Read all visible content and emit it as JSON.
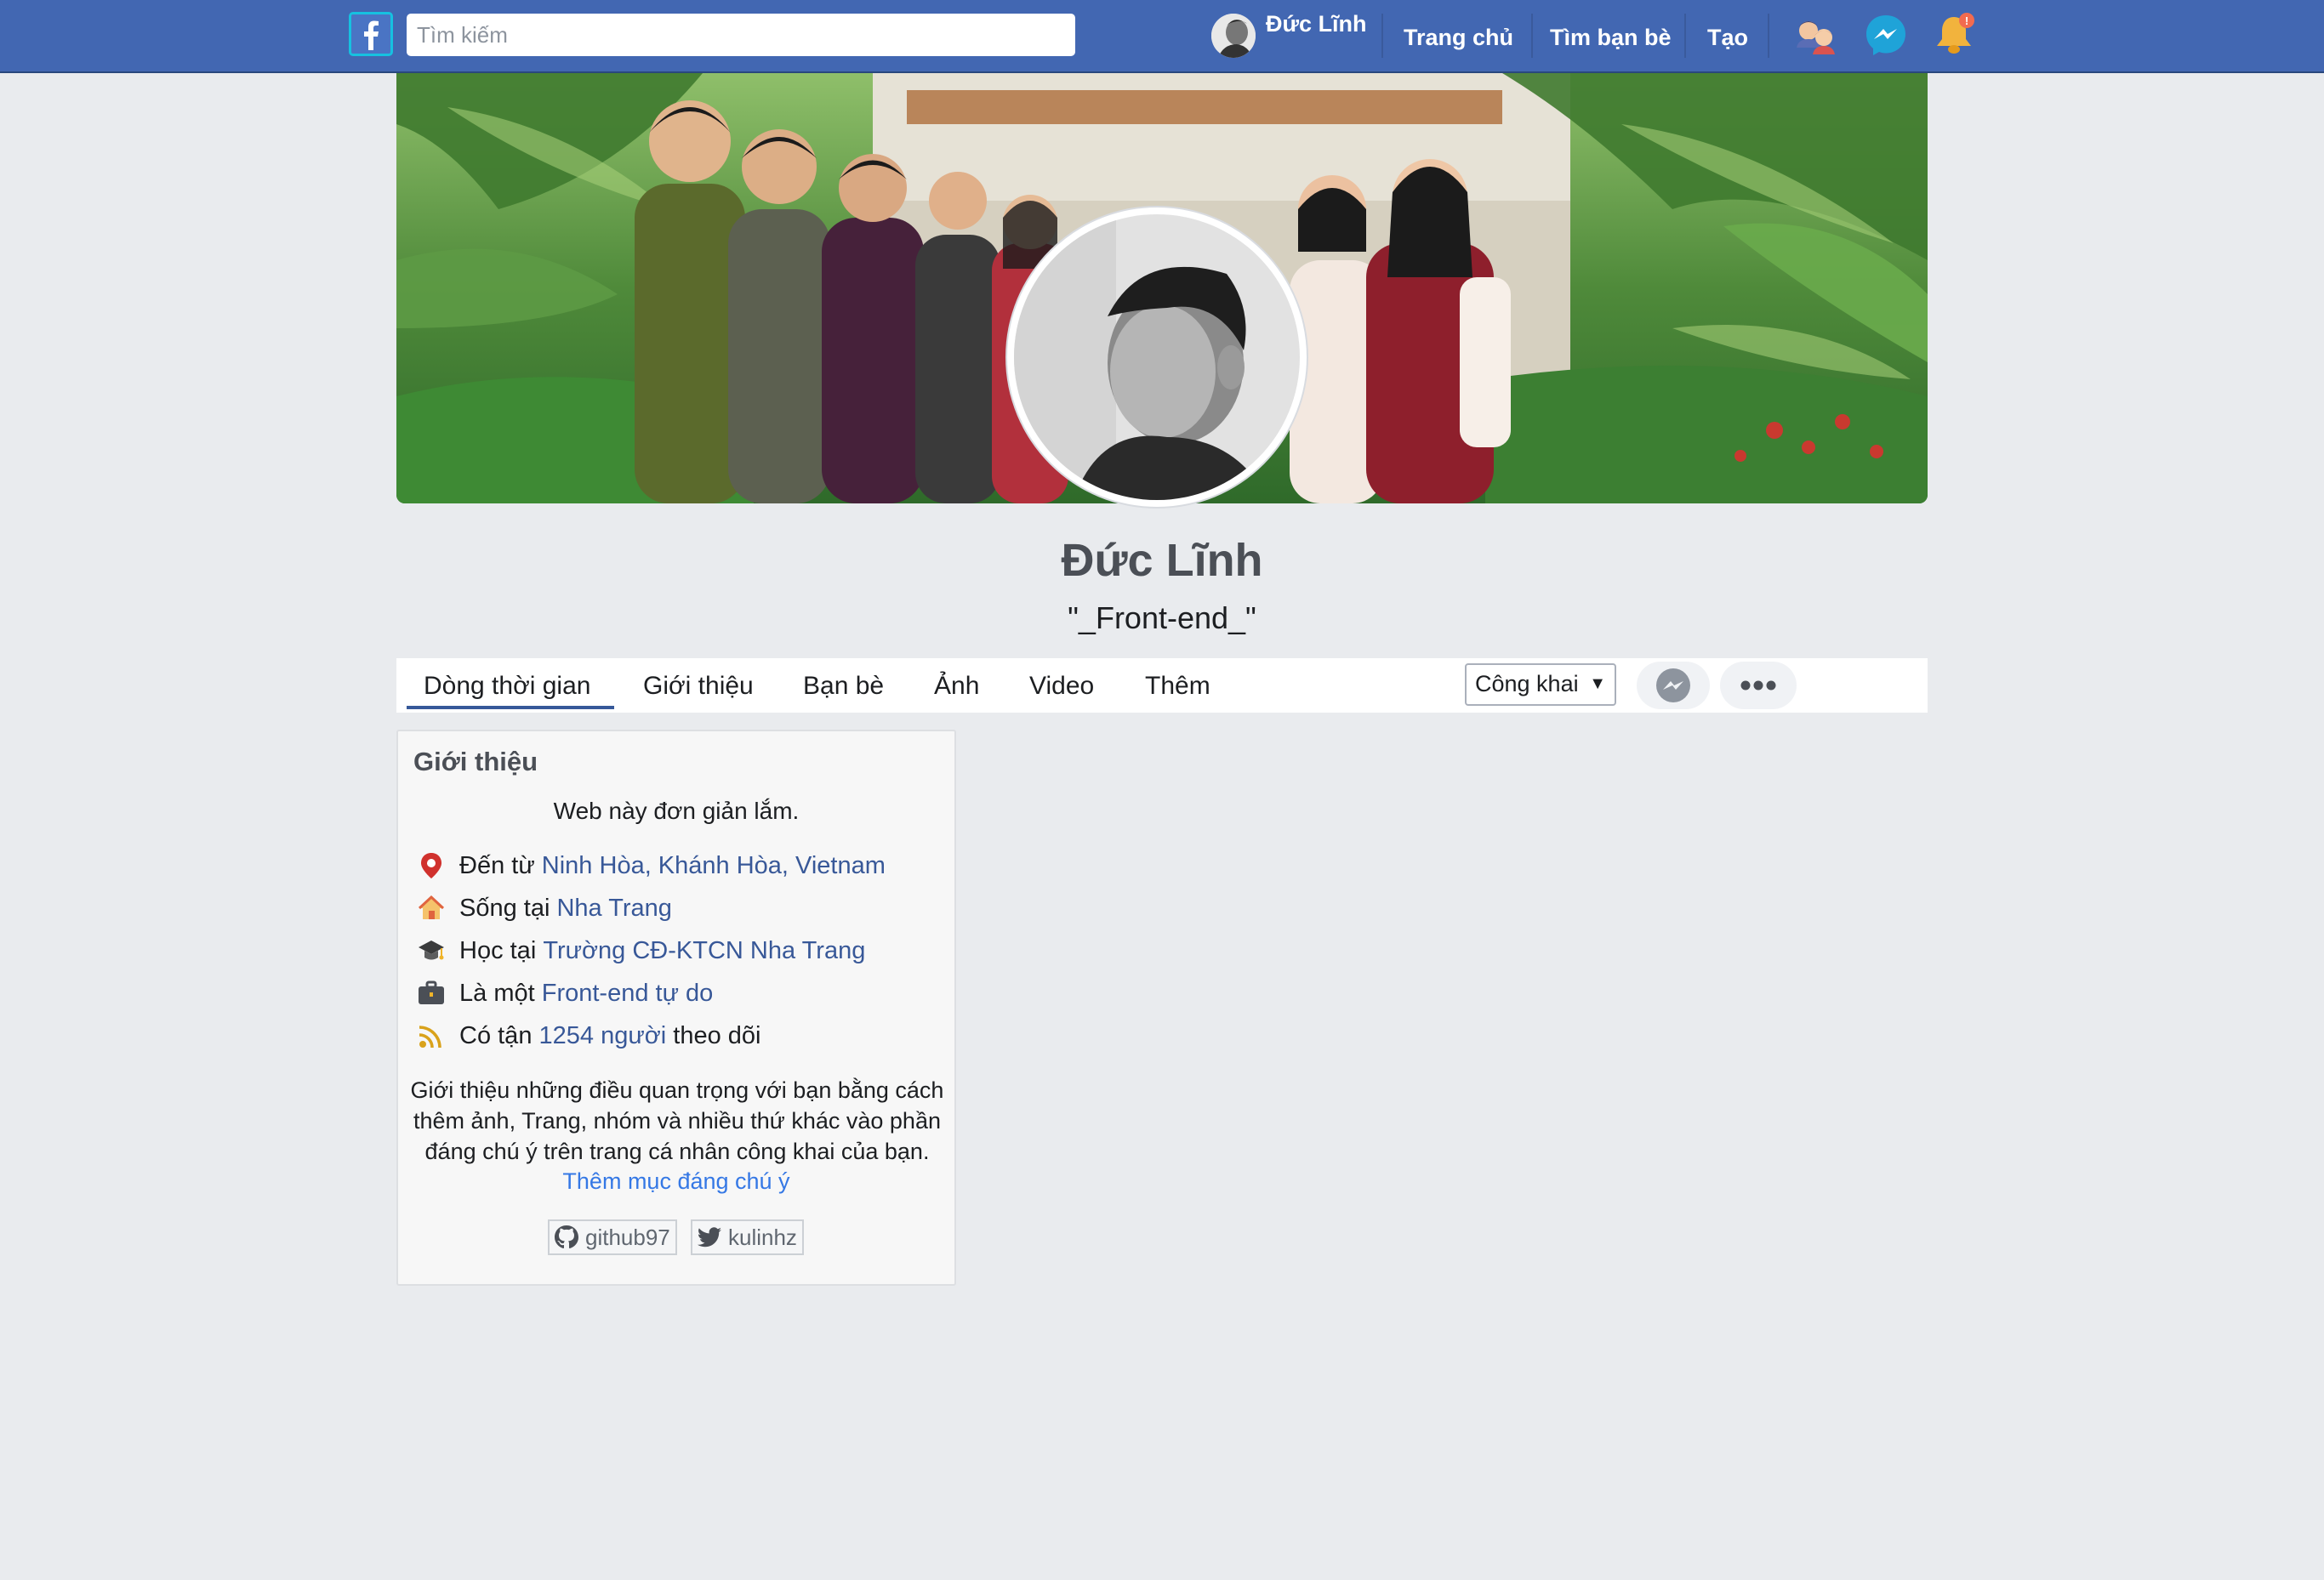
{
  "topbar": {
    "logo_icon": "facebook-logo-icon",
    "search_placeholder": "Tìm kiếm",
    "user_name": "Đức Lĩnh",
    "nav_links": [
      "Trang chủ",
      "Tìm bạn bè",
      "Tạo"
    ],
    "icons": [
      "friend-requests-icon",
      "messenger-icon",
      "notifications-icon"
    ],
    "accent_color": "#4267b2"
  },
  "profile": {
    "name": "Đức Lĩnh",
    "bio": "\"_Front-end_\""
  },
  "tabs": {
    "items": [
      "Dòng thời gian",
      "Giới thiệu",
      "Bạn bè",
      "Ảnh",
      "Video",
      "Thêm"
    ],
    "active_index": 0,
    "privacy_value": "Công khai",
    "privacy_arrow": "▼"
  },
  "intro": {
    "title": "Giới thiệu",
    "description": "Web này đơn giản lắm.",
    "rows": [
      {
        "icon": "location-pin-icon",
        "prefix": "Đến từ ",
        "link": "Ninh Hòa, Khánh Hòa, Vietnam",
        "suffix": ""
      },
      {
        "icon": "home-icon",
        "prefix": "Sống tại ",
        "link": "Nha Trang",
        "suffix": ""
      },
      {
        "icon": "graduation-cap-icon",
        "prefix": "Học tại ",
        "link": "Trường CĐ-KTCN Nha Trang",
        "suffix": ""
      },
      {
        "icon": "briefcase-icon",
        "prefix": "Là một ",
        "link": "Front-end tự do",
        "suffix": ""
      },
      {
        "icon": "rss-feed-icon",
        "prefix": "Có tận ",
        "link": "1254 người",
        "suffix": " theo dõi"
      }
    ],
    "note": "Giới thiệu những điều quan trọng với bạn bằng cách thêm ảnh, Trang, nhóm và nhiều thứ khác vào phần đáng chú ý trên trang cá nhân công khai của bạn.",
    "note_link": "Thêm mục đáng chú ý",
    "social": [
      {
        "icon": "github-icon",
        "label": "github97"
      },
      {
        "icon": "twitter-icon",
        "label": "kulinhz"
      }
    ]
  }
}
